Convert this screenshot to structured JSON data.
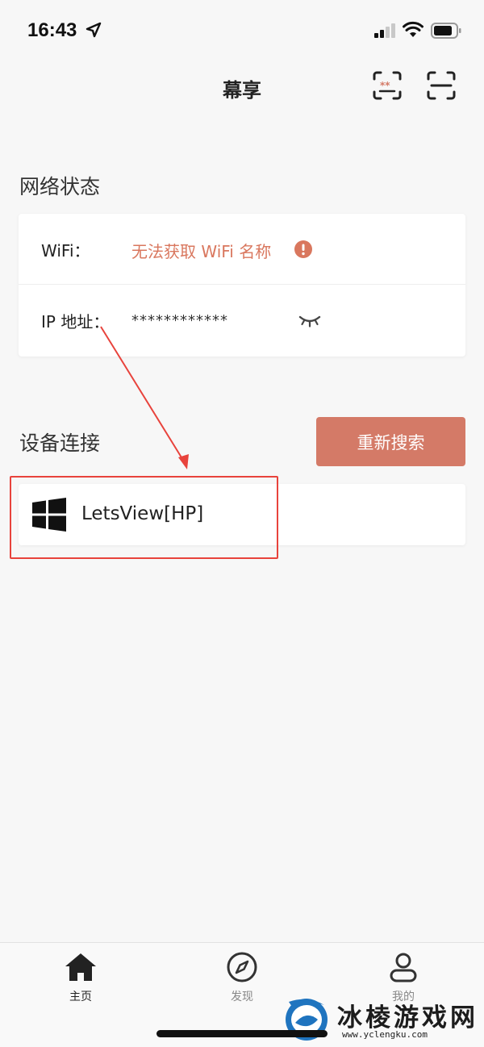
{
  "status_bar": {
    "time": "16:43",
    "icons": [
      "location-arrow-icon",
      "signal-icon",
      "wifi-icon",
      "battery-icon"
    ]
  },
  "navbar": {
    "title": "幕享",
    "icons": [
      "cast-icon",
      "scan-icon"
    ]
  },
  "network": {
    "section_title": "网络状态",
    "wifi_label": "WiFi：",
    "wifi_value": "无法获取 WiFi 名称",
    "ip_label": "IP 地址：",
    "ip_value": "************",
    "icons": [
      "warning-icon",
      "eye-closed-icon"
    ]
  },
  "devices": {
    "section_title": "设备连接",
    "research_label": "重新搜索",
    "items": [
      {
        "name": "LetsView[HP]",
        "icon": "windows-icon"
      }
    ]
  },
  "tabs": [
    {
      "label": "主页",
      "icon": "home-icon",
      "active": true
    },
    {
      "label": "发现",
      "icon": "compass-icon",
      "active": false
    },
    {
      "label": "我的",
      "icon": "user-icon",
      "active": false
    }
  ],
  "watermark": {
    "text": "冰棱游戏网",
    "url": "www.yclengku.com"
  },
  "colors": {
    "accent": "#d47a67",
    "warning_text": "#d9775e",
    "annotation": "#e8433c",
    "background": "#f7f7f7"
  }
}
